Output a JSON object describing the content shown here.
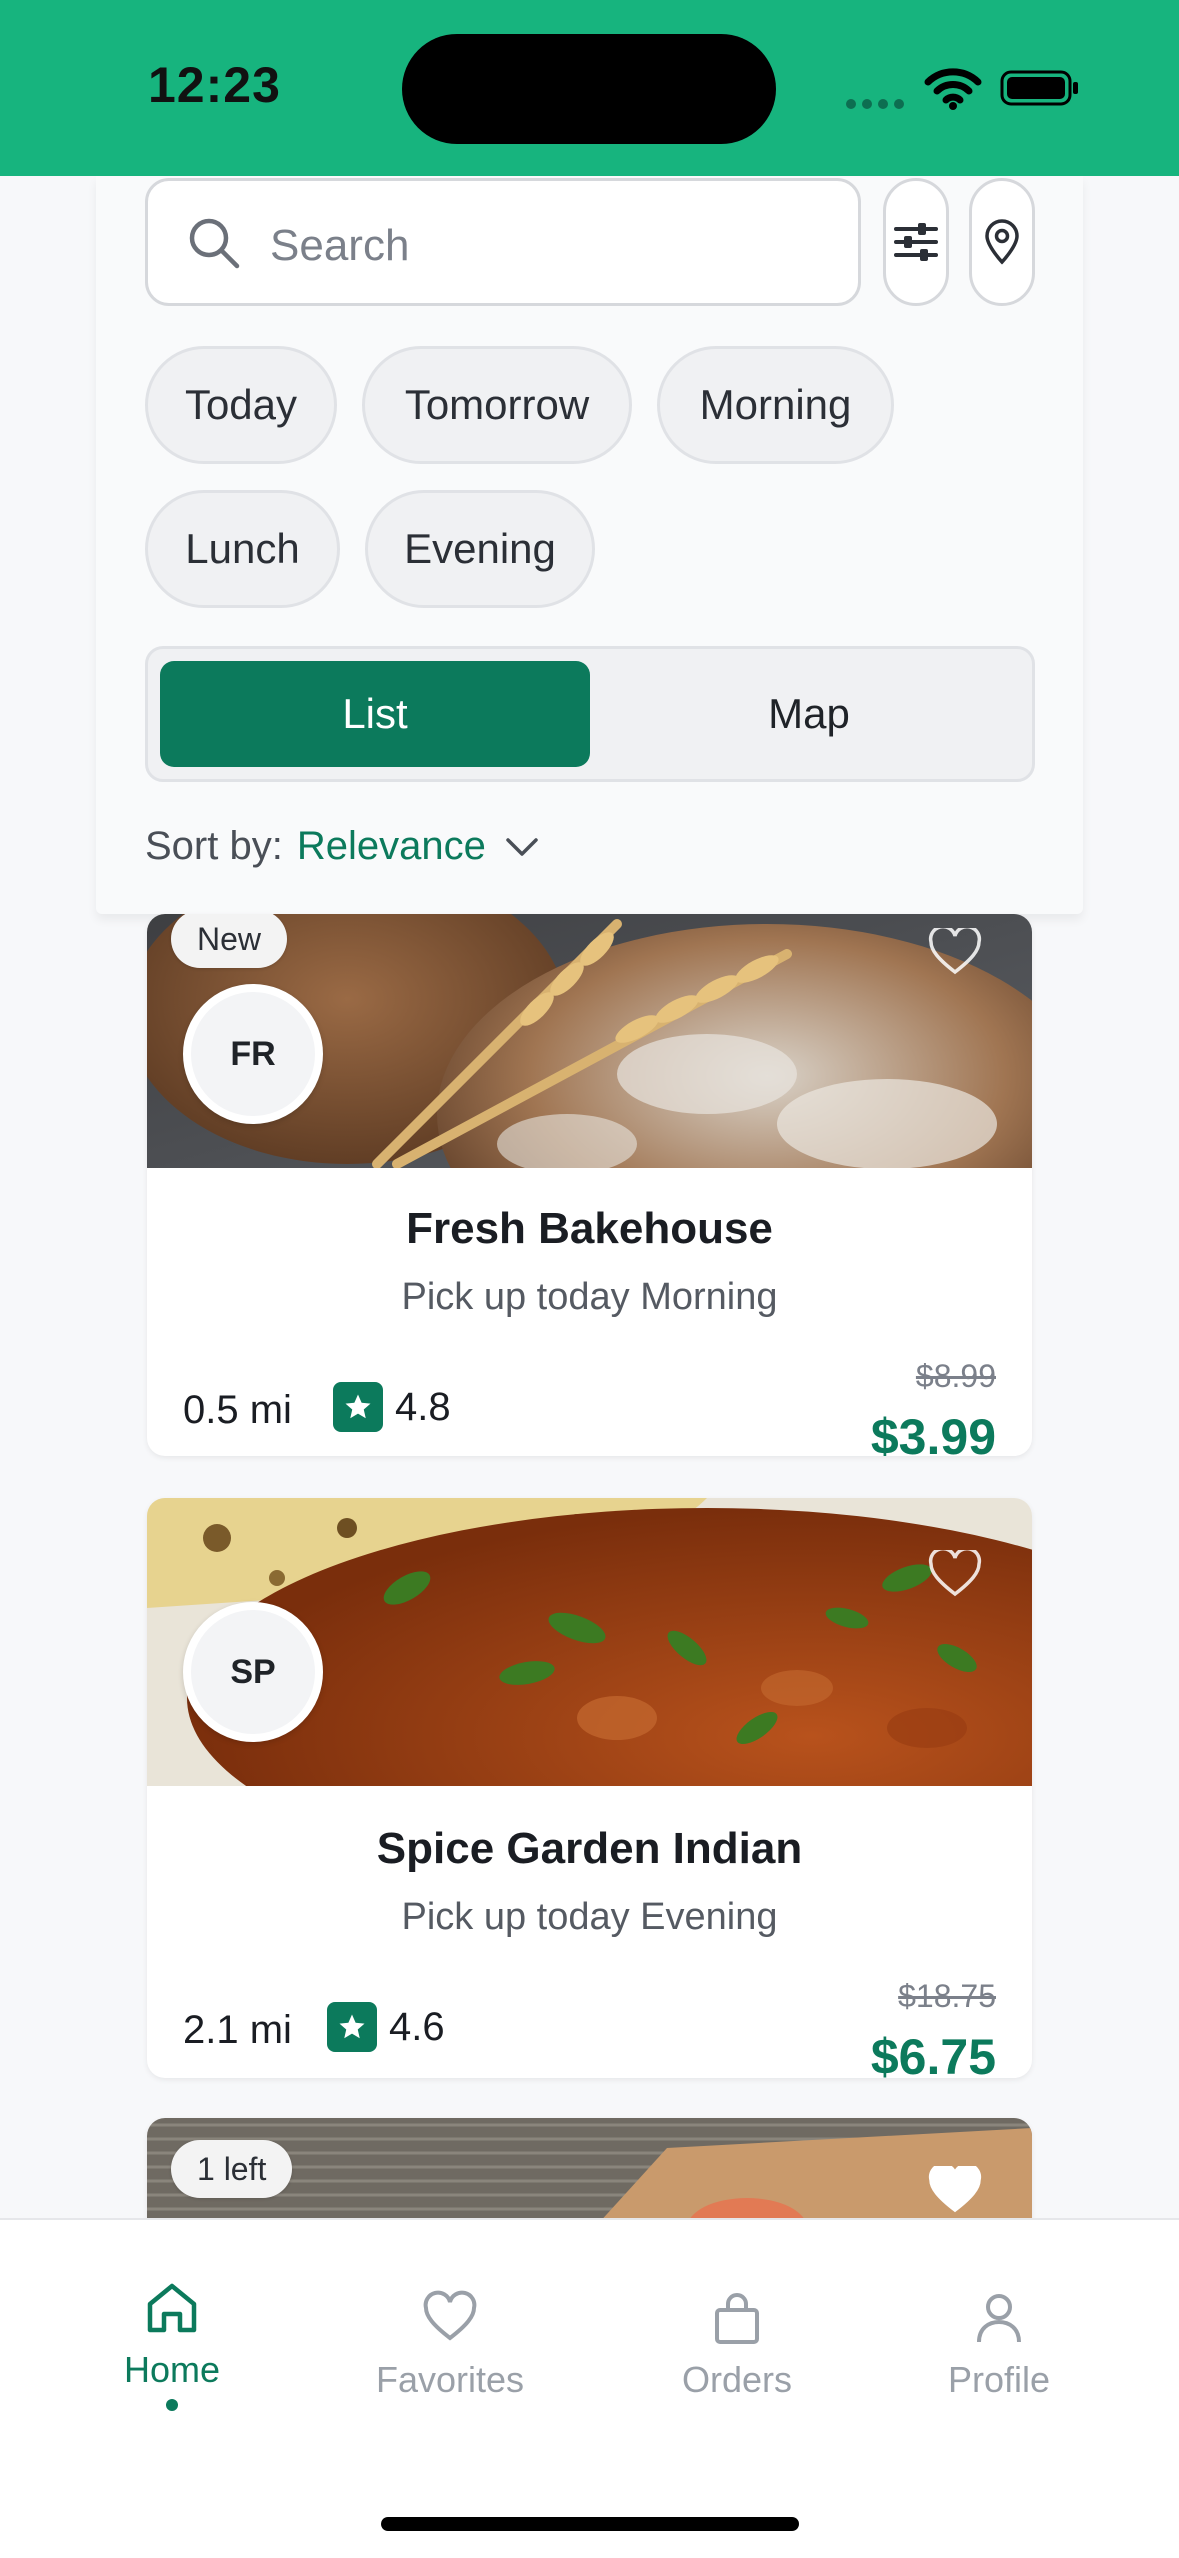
{
  "status": {
    "time": "12:23"
  },
  "search": {
    "placeholder": "Search"
  },
  "chips": [
    "Today",
    "Tomorrow",
    "Morning",
    "Lunch",
    "Evening"
  ],
  "view_toggle": {
    "list": "List",
    "map": "Map",
    "selected": "List"
  },
  "sort": {
    "label": "Sort by:",
    "value": "Relevance"
  },
  "listings": [
    {
      "badge": "New",
      "initials": "FR",
      "name": "Fresh Bakehouse",
      "pickup": "Pick up today Morning",
      "distance": "0.5 mi",
      "rating": "4.8",
      "old_price": "$8.99",
      "price": "$3.99",
      "image": "bread-loaves"
    },
    {
      "badge": "",
      "initials": "SP",
      "name": "Spice Garden Indian",
      "pickup": "Pick up today Evening",
      "distance": "2.1 mi",
      "rating": "4.6",
      "old_price": "$18.75",
      "price": "$6.75",
      "image": "curry-naan"
    },
    {
      "badge": "1 left",
      "image": "sushi-board"
    }
  ],
  "tabs": [
    {
      "label": "Home",
      "icon": "home-icon",
      "active": true
    },
    {
      "label": "Favorites",
      "icon": "heart-icon",
      "active": false
    },
    {
      "label": "Orders",
      "icon": "bag-icon",
      "active": false
    },
    {
      "label": "Profile",
      "icon": "person-icon",
      "active": false
    }
  ],
  "colors": {
    "status_bar": "#17b47e",
    "accent": "#0c7a5c"
  }
}
